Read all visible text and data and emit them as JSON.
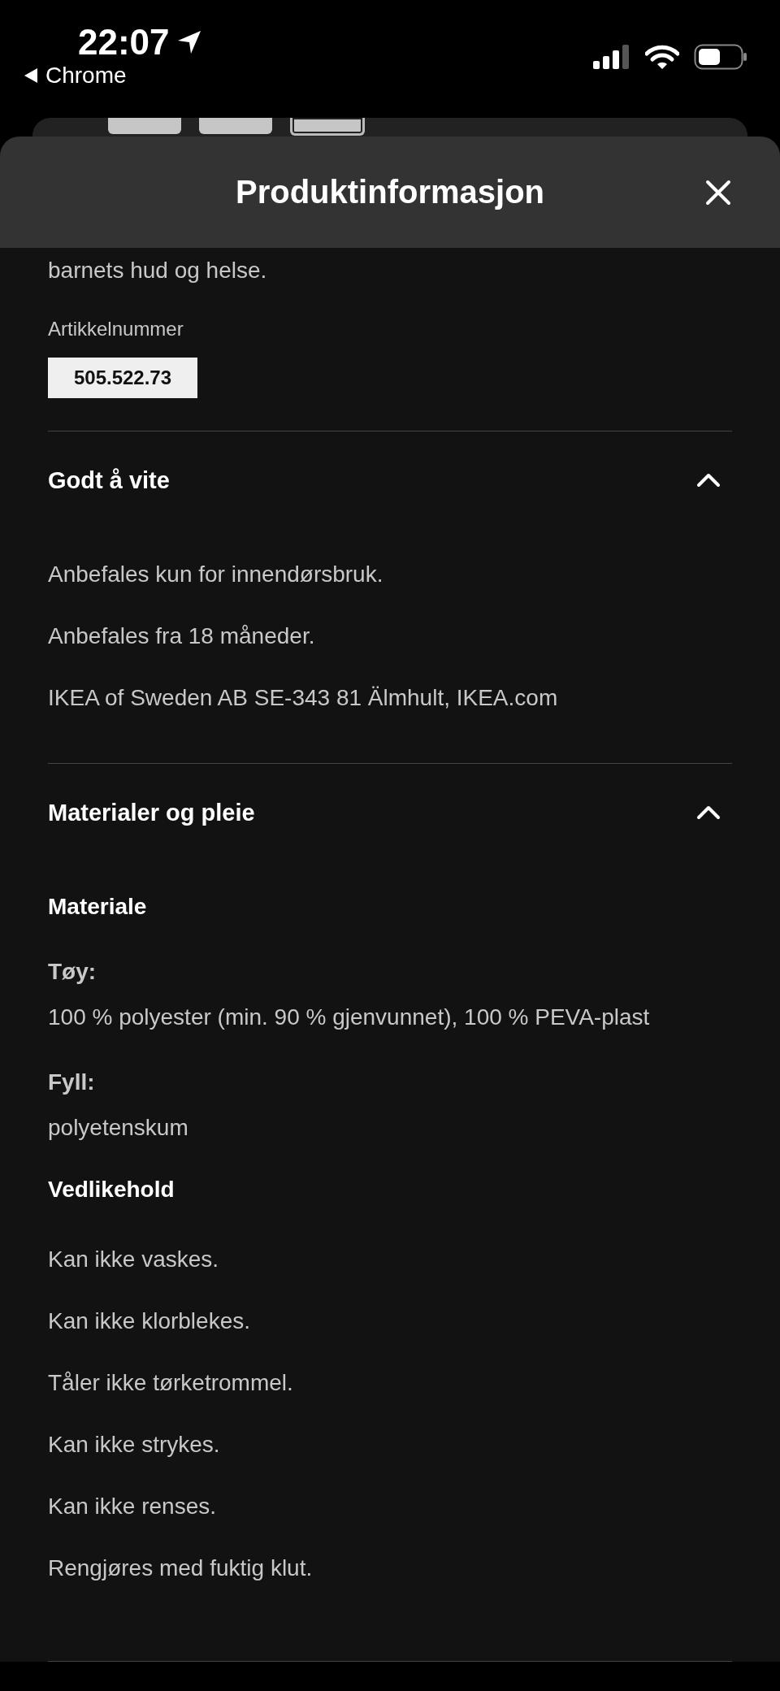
{
  "status_bar": {
    "time": "22:07",
    "back_label": "Chrome"
  },
  "gallery": {
    "thumbnails": [
      {
        "selected": false
      },
      {
        "selected": false
      },
      {
        "selected": true
      }
    ]
  },
  "sheet": {
    "title": "Produktinformasjon",
    "intro_tail": "barnets hud og helse.",
    "article_label": "Artikkelnummer",
    "article_number": "505.522.73",
    "sections": [
      {
        "title": "Godt å vite",
        "expanded": true,
        "blocks": [
          {
            "kind": "paragraph",
            "text": "Anbefales kun for innendørsbruk."
          },
          {
            "kind": "paragraph",
            "text": "Anbefales fra 18 måneder."
          },
          {
            "kind": "paragraph",
            "text": "IKEA of Sweden AB SE-343 81 Älmhult, IKEA.com"
          }
        ]
      },
      {
        "title": "Materialer og pleie",
        "expanded": true,
        "blocks": [
          {
            "kind": "heading",
            "text": "Materiale"
          },
          {
            "kind": "label",
            "text": "Tøy:"
          },
          {
            "kind": "value",
            "text": "100 % polyester (min. 90 % gjenvunnet), 100 % PEVA-plast"
          },
          {
            "kind": "label",
            "text": "Fyll:"
          },
          {
            "kind": "value",
            "text": "polyetenskum"
          },
          {
            "kind": "heading",
            "text": "Vedlikehold"
          },
          {
            "kind": "paragraph",
            "text": "Kan ikke vaskes."
          },
          {
            "kind": "paragraph",
            "text": "Kan ikke klorblekes."
          },
          {
            "kind": "paragraph",
            "text": "Tåler ikke tørketrommel."
          },
          {
            "kind": "paragraph",
            "text": "Kan ikke strykes."
          },
          {
            "kind": "paragraph",
            "text": "Kan ikke renses."
          },
          {
            "kind": "paragraph",
            "text": "Rengjøres med fuktig klut."
          }
        ]
      }
    ]
  }
}
